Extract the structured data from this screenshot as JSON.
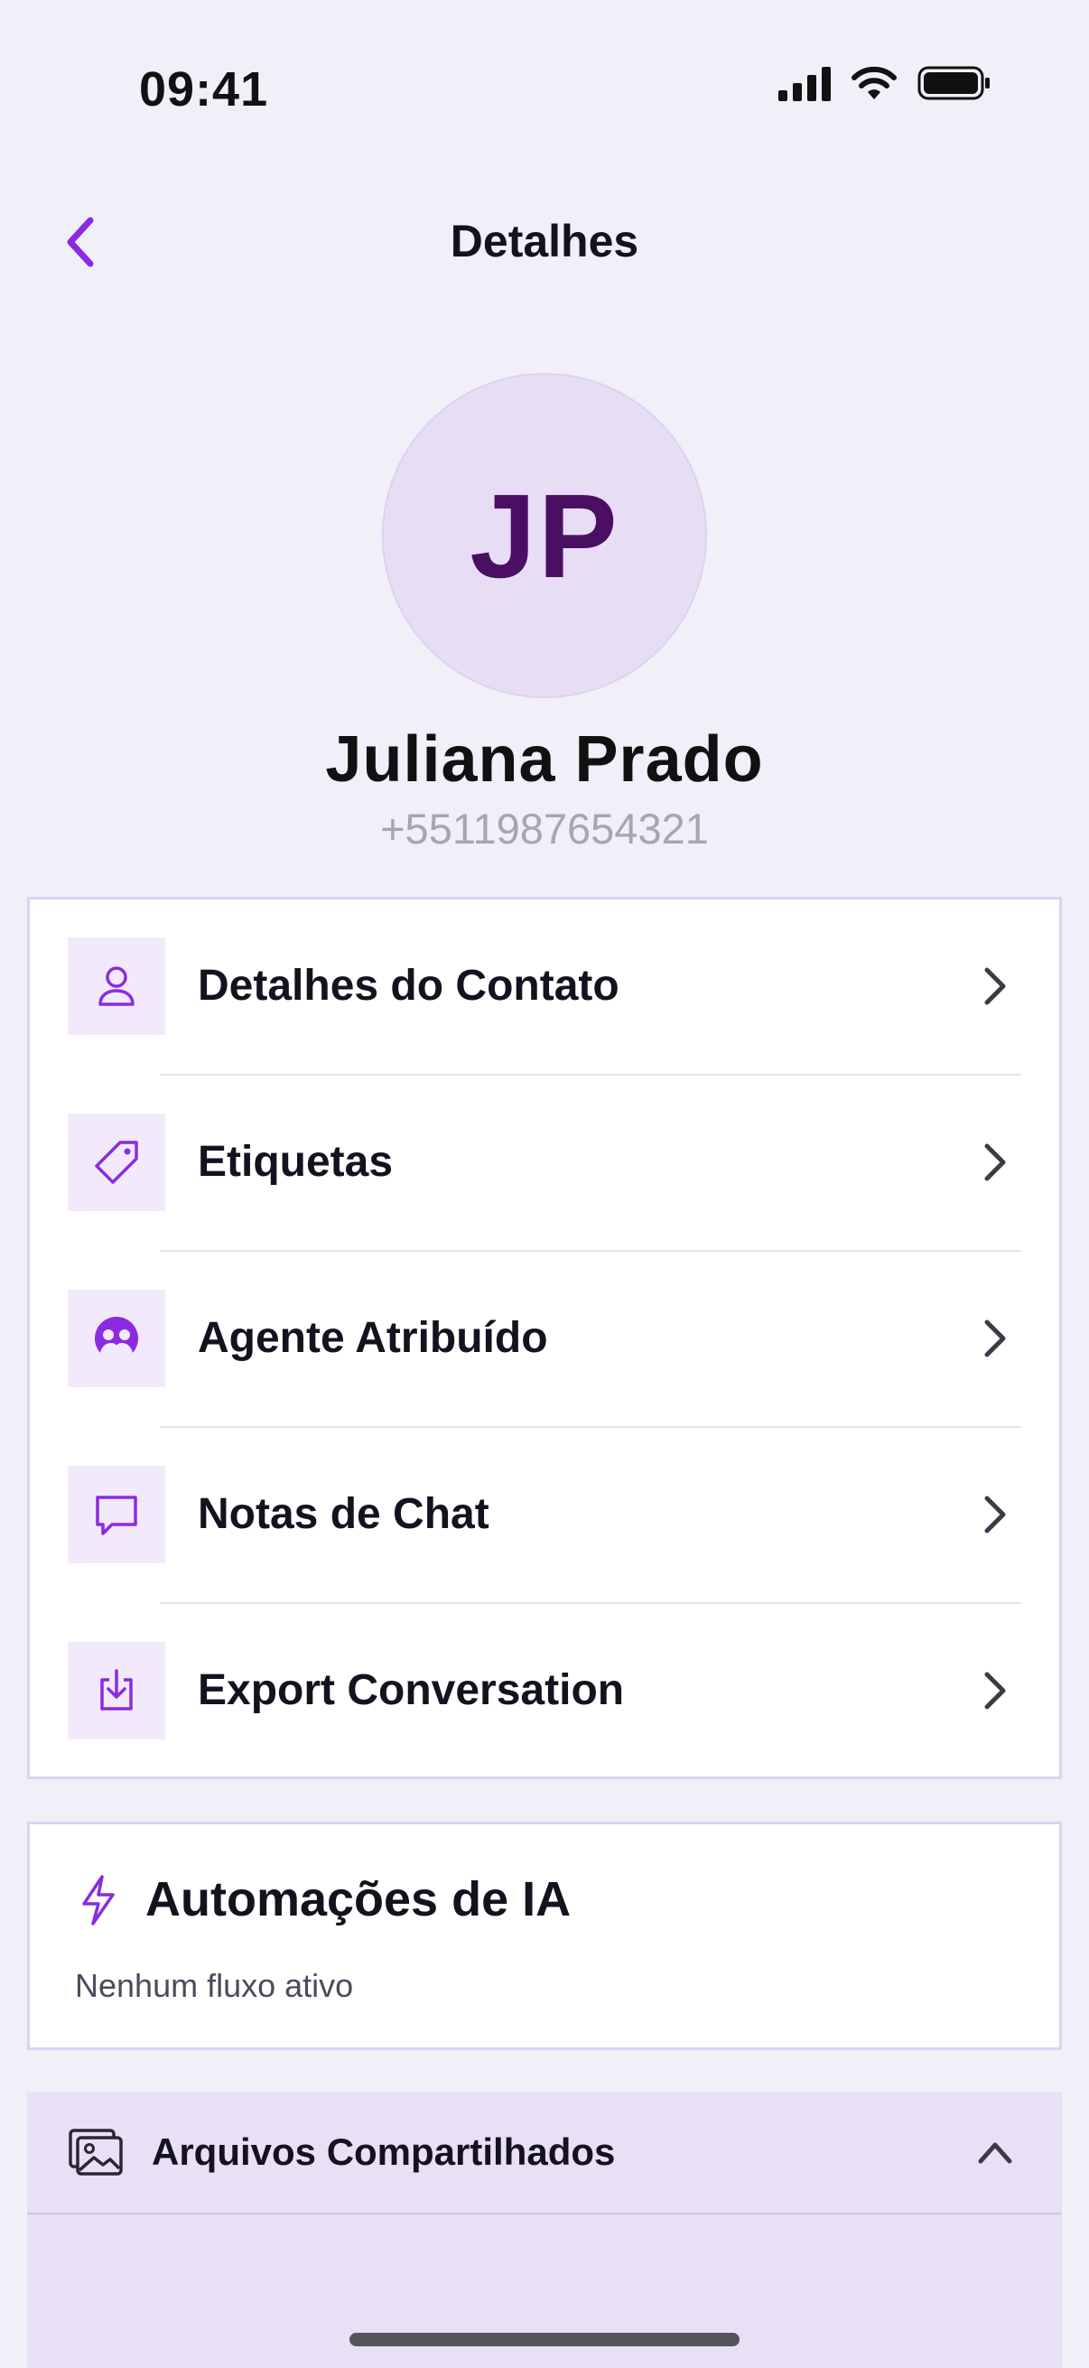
{
  "status_bar": {
    "time": "09:41",
    "icons": [
      "signal-icon",
      "wifi-icon",
      "battery-icon"
    ]
  },
  "header": {
    "title": "Detalhes",
    "back_icon": "chevron-left-icon"
  },
  "profile": {
    "initials": "JP",
    "name": "Juliana Prado",
    "phone": "+5511987654321"
  },
  "menu": {
    "items": [
      {
        "label": "Detalhes do Contato",
        "icon": "user-icon"
      },
      {
        "label": "Etiquetas",
        "icon": "tag-icon"
      },
      {
        "label": "Agente Atribuído",
        "icon": "agent-icon"
      },
      {
        "label": "Notas de Chat",
        "icon": "chat-bubble-icon"
      },
      {
        "label": "Export Conversation",
        "icon": "download-icon"
      }
    ]
  },
  "automations": {
    "title": "Automações de IA",
    "subtitle": "Nenhum fluxo ativo",
    "icon": "lightning-icon"
  },
  "shared_files": {
    "title": "Arquivos Compartilhados",
    "icon": "images-icon",
    "toggle_icon": "chevron-up-icon"
  },
  "colors": {
    "accent": "#8a2be2",
    "background": "#f1eff7",
    "avatar_bg": "#e7def6",
    "avatar_text": "#4a0f63",
    "icon_box_bg": "#f2eafc",
    "card_border": "#d9d4f3",
    "files_bg": "#e9e0f6"
  }
}
